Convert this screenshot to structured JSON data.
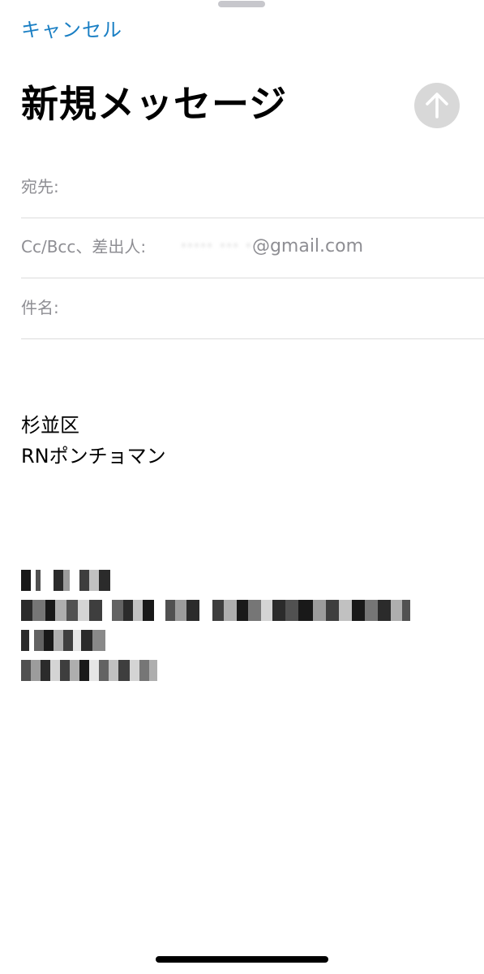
{
  "header": {
    "cancel_label": "キャンセル",
    "title": "新規メッセージ",
    "send_icon": "arrow-up-icon"
  },
  "fields": {
    "to_label": "宛先:",
    "cc_from_label": "Cc/Bcc、差出人:",
    "from_email_redacted": "·····  ··· ·",
    "from_email_domain": "@gmail.com",
    "subject_label": "件名:"
  },
  "body": {
    "signature_line1": "杉並区",
    "signature_line2": "RNポンチョマン"
  },
  "colors": {
    "accent": "#1a7fc4",
    "label": "#8e8e93",
    "divider": "#dcdcdc",
    "send_disabled": "#d8d8d8"
  }
}
